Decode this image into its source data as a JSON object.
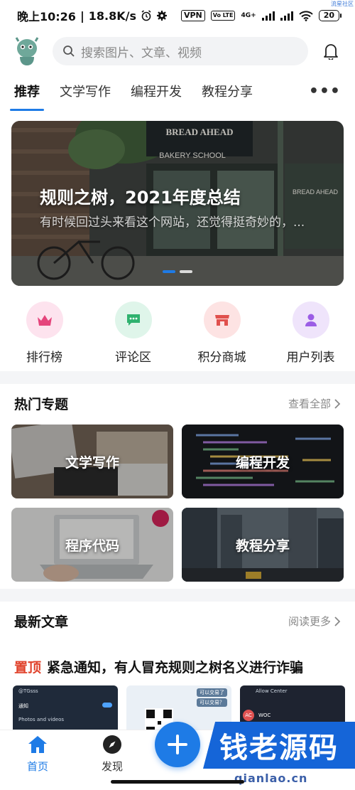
{
  "status": {
    "time": "晚上10:26",
    "speed": "18.8K/s",
    "vpn": "VPN",
    "volte": "Vo LTE",
    "net": "4G+",
    "battery": "20",
    "corner_tag": "流星社区"
  },
  "search": {
    "placeholder": "搜索图片、文章、视频"
  },
  "tabs": [
    {
      "label": "推荐",
      "active": true
    },
    {
      "label": "文学写作"
    },
    {
      "label": "编程开发"
    },
    {
      "label": "教程分享"
    }
  ],
  "banner": {
    "title": "规则之树，2021年度总结",
    "subtitle": "有时候回过头来看这个网站，还觉得挺奇妙的，...",
    "shop_sign": "BREAD AHEAD",
    "shop_sign_sub": "BAKERY SCHOOL",
    "window_sign": "BREAD AHEAD",
    "slide_index": 0,
    "slide_count": 2
  },
  "quick_links": [
    {
      "label": "排行榜",
      "icon": "crown-icon",
      "bg": "#fde3ee",
      "fg": "#e5457c"
    },
    {
      "label": "评论区",
      "icon": "comment-icon",
      "bg": "#dff5ea",
      "fg": "#2fb26f"
    },
    {
      "label": "积分商城",
      "icon": "store-icon",
      "bg": "#fde3e3",
      "fg": "#e0504d"
    },
    {
      "label": "用户列表",
      "icon": "user-icon",
      "bg": "#efe4fb",
      "fg": "#9b5de5"
    }
  ],
  "hot": {
    "title": "热门专题",
    "more": "查看全部",
    "topics": [
      {
        "label": "文学写作",
        "scene": "desk"
      },
      {
        "label": "编程开发",
        "scene": "code"
      },
      {
        "label": "程序代码",
        "scene": "laptop"
      },
      {
        "label": "教程分享",
        "scene": "city"
      }
    ]
  },
  "latest": {
    "title": "最新文章",
    "more": "阅读更多",
    "pinned_tag": "置顶",
    "pinned_title": "紧急通知，有人冒充规则之树名义进行诈骗",
    "thumb1": {
      "header": "@TGsss",
      "row1": "通知",
      "row2": "Photos and videos"
    },
    "thumb2": {
      "bubble1": "可以交易了",
      "bubble2": "可以交易？"
    },
    "thumb3": {
      "header": "Allow Center",
      "tag": "AC",
      "row": "WOC"
    }
  },
  "nav": [
    {
      "label": "首页",
      "icon": "home-icon",
      "active": true
    },
    {
      "label": "发现",
      "icon": "compass-icon"
    }
  ],
  "watermark": {
    "text": "钱老源码",
    "url": "qianlao.cn"
  },
  "colors": {
    "accent": "#1e7be6",
    "pinned": "#e0432c"
  }
}
